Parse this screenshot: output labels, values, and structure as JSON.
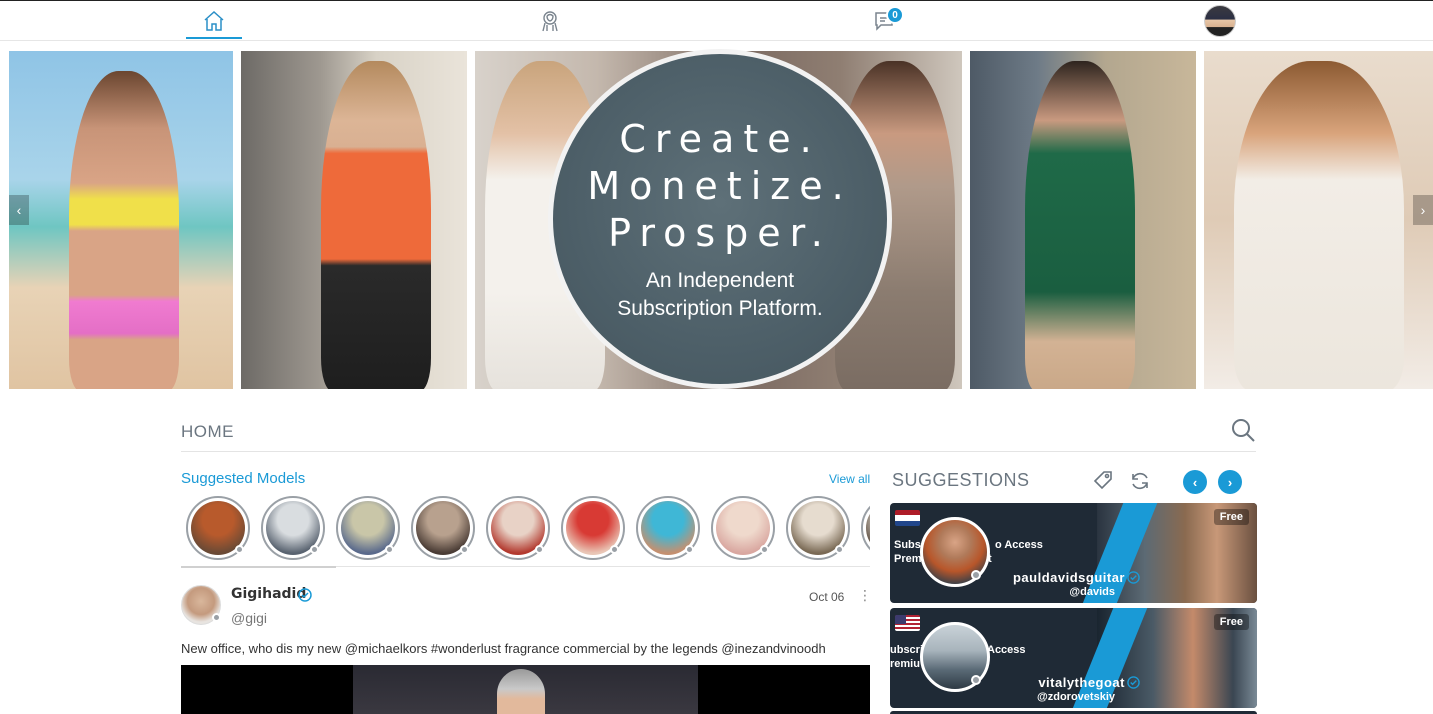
{
  "nav": {
    "home_icon": "home-icon",
    "models_icon": "model-icon",
    "messages_icon": "chat-icon",
    "messages_badge": "0",
    "avatar": "user-avatar"
  },
  "banner": {
    "promo_line1": "Create.",
    "promo_line2": "Monetize.",
    "promo_line3": "Prosper.",
    "promo_sub1": "An Independent",
    "promo_sub2": "Subscription Platform.",
    "prev_label": "‹",
    "next_label": "›"
  },
  "home": {
    "title": "HOME"
  },
  "suggested_models": {
    "title": "Suggested Models",
    "view_all": "View all",
    "items": [
      {
        "color1": "#b85a2c",
        "color2": "#6a4a35"
      },
      {
        "color1": "#d9dde0",
        "color2": "#596370"
      },
      {
        "color1": "#c9c6a8",
        "color2": "#5a6a8c"
      },
      {
        "color1": "#b8a18e",
        "color2": "#4a3c35"
      },
      {
        "color1": "#e8d2c6",
        "color2": "#b33a2f"
      },
      {
        "color1": "#d83a34",
        "color2": "#e9c6b6"
      },
      {
        "color1": "#3fb7d6",
        "color2": "#c49070"
      },
      {
        "color1": "#efd9cc",
        "color2": "#d9a7a0"
      },
      {
        "color1": "#e6dccf",
        "color2": "#7a6a55"
      },
      {
        "color1": "#d9d4cc",
        "color2": "#5a4a3c"
      }
    ]
  },
  "post": {
    "name": "Gigihadid",
    "handle": "@gigi",
    "date": "Oct 06",
    "more": "⋮",
    "text": "New office, who dis my new @michaelkors #wonderlust fragrance commercial by the legends @inezandvinoodh"
  },
  "suggestions": {
    "title": "SUGGESTIONS",
    "prev_label": "‹",
    "next_label": "›",
    "cards": [
      {
        "flag": "netherlands-flag",
        "free": "Free",
        "promo_top": "Subs",
        "promo_mid": "o Access",
        "promo_bot": "Prem",
        "promo_bot2": "it",
        "name": "pauldavidsguitar",
        "handle": "@davids"
      },
      {
        "flag": "usa-flag",
        "free": "Free",
        "promo_top": "ubscri",
        "promo_mid": "Access",
        "promo_bot": "remiu",
        "promo_bot2": "",
        "name": "vitalythegoat",
        "handle": "@zdorovetskiy"
      }
    ]
  }
}
